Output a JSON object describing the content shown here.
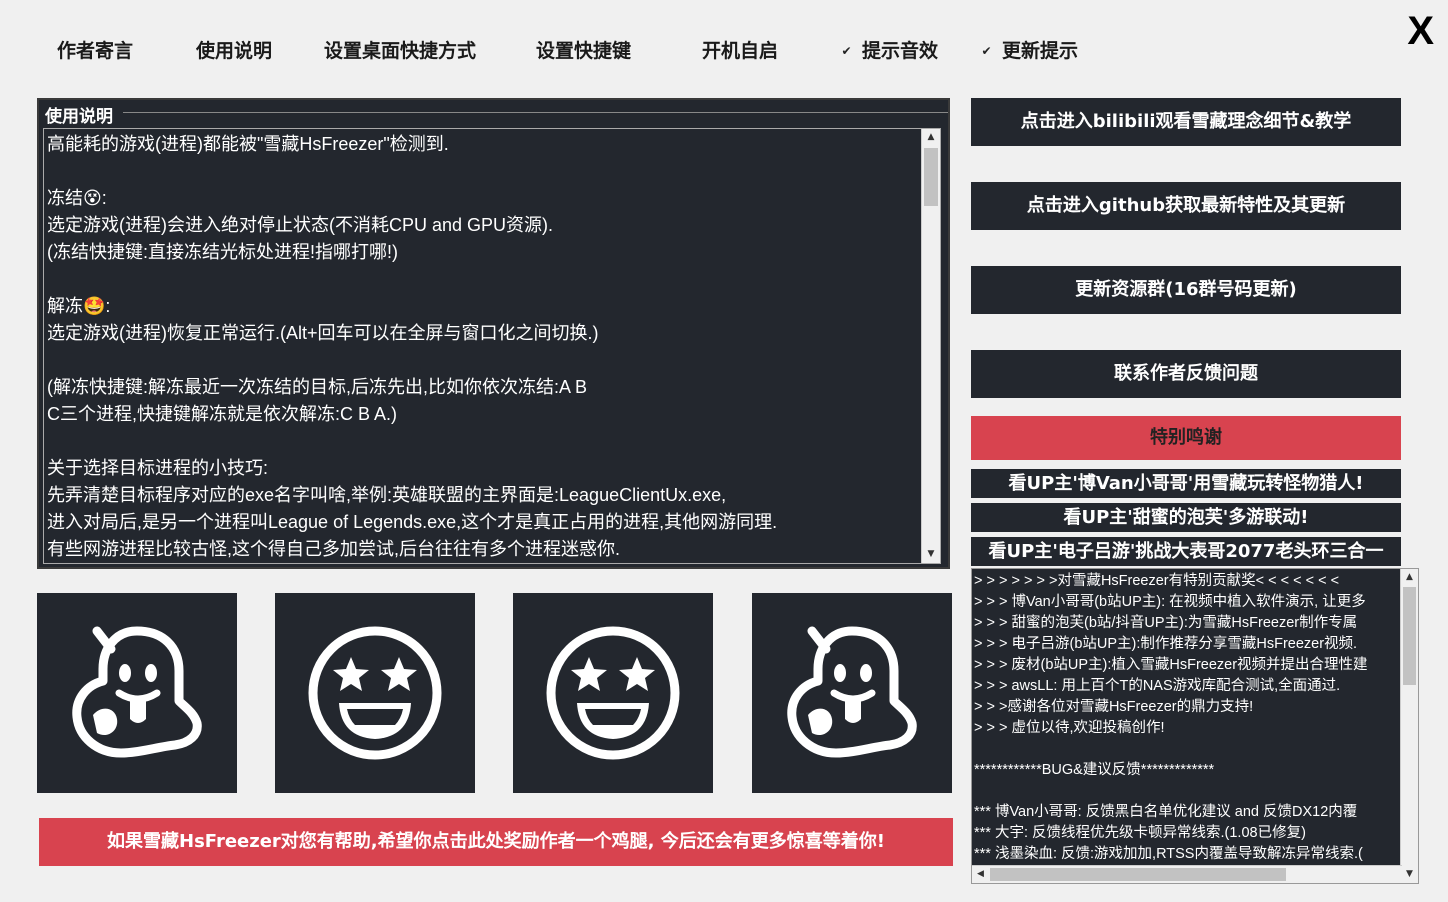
{
  "menu": {
    "author_note": "作者寄言",
    "instructions": "使用说明",
    "desktop_shortcut": "设置桌面快捷方式",
    "hotkeys": "设置快捷键",
    "autostart": "开机自启",
    "sound_hint": "提示音效",
    "sound_hint_checked": true,
    "update_hint": "更新提示",
    "update_hint_checked": true,
    "close": "X"
  },
  "usage": {
    "legend": "使用说明",
    "text": "高能耗的游戏(进程)都能被\"雪藏HsFreezer\"检测到.\n\n冻结😵:\n选定游戏(进程)会进入绝对停止状态(不消耗CPU and GPU资源).\n(冻结快捷键:直接冻结光标处进程!指哪打哪!)\n\n解冻🤩:\n选定游戏(进程)恢复正常运行.(Alt+回车可以在全屏与窗口化之间切换.)\n\n(解冻快捷键:解冻最近一次冻结的目标,后冻先出,比如你依次冻结:A B\nC三个进程,快捷键解冻就是依次解冻:C B A.)\n\n关于选择目标进程的小技巧:\n先弄清楚目标程序对应的exe名字叫啥,举例:英雄联盟的主界面是:LeagueClientUx.exe,\n进入对局后,是另一个进程叫League of Legends.exe,这个才是真正占用的进程,其他网游同理.\n有些网游进程比较古怪,这个得自己多加尝试,后台往往有多个进程迷惑你."
  },
  "tiles": [
    {
      "icon": "ghost-tongue-icon"
    },
    {
      "icon": "star-struck-icon"
    },
    {
      "icon": "star-struck-icon"
    },
    {
      "icon": "ghost-tongue-icon"
    }
  ],
  "banner": "如果雪藏HsFreezer对您有帮助,希望你点击此处奖励作者一个鸡腿, 今后还会有更多惊喜等着你!",
  "right": {
    "bilibili": "点击进入bilibili观看雪藏理念细节&教学",
    "github": "点击进入github获取最新特性及其更新",
    "group": "更新资源群(16群号码更新)",
    "contact": "联系作者反馈问题",
    "thanks": "特别鸣谢",
    "up1": "看UP主'博Van小哥哥'用雪藏玩转怪物猎人!",
    "up2": "看UP主'甜蜜的泡芙'多游联动!",
    "up3": "看UP主'电子吕游'挑战大表哥2077老头环三合一"
  },
  "credits": "> > > > > > >对雪藏HsFreezer有特别贡献奖< < < < < < <\n> > > 博Van小哥哥(b站UP主): 在视频中植入软件演示, 让更多\n> > > 甜蜜的泡芙(b站/抖音UP主):为雪藏HsFreezer制作专属\n> > > 电子吕游(b站UP主):制作推荐分享雪藏HsFreezer视频.\n> > > 废材(b站UP主):植入雪藏HsFreezer视频并提出合理性建\n> > > awsLL: 用上百个T的NAS游戏库配合测试,全面通过.\n> > >感谢各位对雪藏HsFreezer的鼎力支持!\n> > > 虚位以待,欢迎投稿创作!\n\n************BUG&建议反馈*************\n\n*** 博Van小哥哥: 反馈黑白名单优化建议 and 反馈DX12内覆\n*** 大宇: 反馈线程优先级卡顿异常线索.(1.08已修复)\n*** 浅墨染血: 反馈:游戏加加,RTSS内覆盖导致解冻异常线索.("
}
